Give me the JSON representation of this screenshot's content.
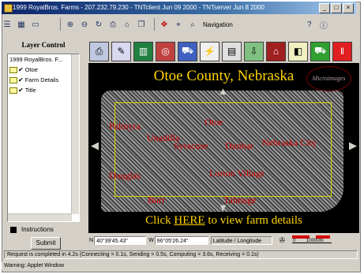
{
  "window": {
    "title": "1999 RoyalBros. Farms - 207.232.79.230 - TNTclient Jun 09 2000 - TNTserver Jun  8 2000",
    "minimize": "_",
    "maximize": "□",
    "close": "×"
  },
  "toolbar": {
    "navigation_label": "Navigation"
  },
  "layer_control": {
    "title": "Layer Control",
    "items": [
      {
        "label": "1999 RoyalBros. F...",
        "checked": false,
        "folder": false
      },
      {
        "label": "Otoe",
        "checked": true,
        "folder": true
      },
      {
        "label": "Farm Details",
        "checked": true,
        "folder": true
      },
      {
        "label": "Title",
        "checked": true,
        "folder": true
      }
    ]
  },
  "instructions_label": "Instructions",
  "submit_label": "Submit",
  "map": {
    "title": "Otoe County, Nebraska",
    "logo_text": "Microimages",
    "towns": [
      "Palmyra",
      "Unadilla",
      "Otoe",
      "Syracuse",
      "Dunbar",
      "Nebraska City",
      "Douglas",
      "Lorton Village",
      "Burr",
      "Talmage"
    ],
    "footer_prefix": "Click ",
    "footer_link": "HERE",
    "footer_suffix": " to view farm details"
  },
  "coords": {
    "n_label": "N",
    "n_value": "40°39'45.43\"",
    "w_label": "W",
    "w_value": "96°05'26.24\"",
    "system": "Latitude / Longitude",
    "scale_start": "0",
    "scale_end": "10000m"
  },
  "status_text": "Request is completed in 4.2s (Connecting = 0.1s, Sending = 0.5s, Computing = 3.6s, Receiving = 0.1s)",
  "applet_text": "Warning: Applet Window"
}
